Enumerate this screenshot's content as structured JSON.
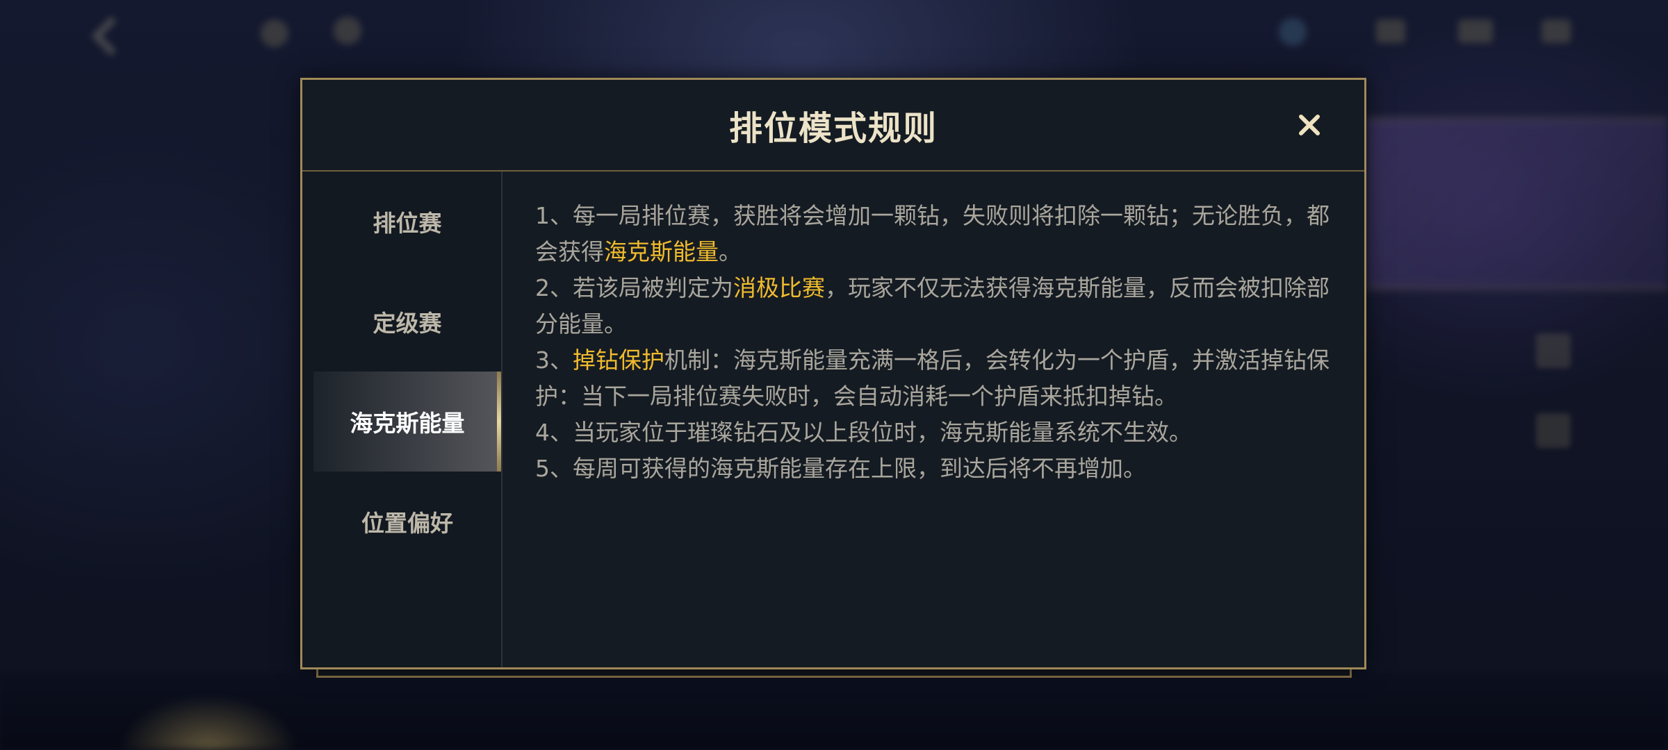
{
  "modal": {
    "title": "排位模式规则",
    "close_icon": "close-icon"
  },
  "sidebar": {
    "items": [
      {
        "label": "排位赛",
        "active": false
      },
      {
        "label": "定级赛",
        "active": false
      },
      {
        "label": "海克斯能量",
        "active": true
      },
      {
        "label": "位置偏好",
        "active": false
      }
    ]
  },
  "rules": [
    {
      "parts": [
        {
          "text": "1、每一局排位赛，获胜将会增加一颗钻，失败则将扣除一颗钻；无论胜负，都会获得"
        },
        {
          "text": "海克斯能量",
          "highlight": true
        },
        {
          "text": "。"
        }
      ]
    },
    {
      "parts": [
        {
          "text": "2、若该局被判定为"
        },
        {
          "text": "消极比赛",
          "highlight": true
        },
        {
          "text": "，玩家不仅无法获得海克斯能量，反而会被扣除部分能量。"
        }
      ]
    },
    {
      "parts": [
        {
          "text": "3、"
        },
        {
          "text": "掉钻保护",
          "highlight": true
        },
        {
          "text": "机制：海克斯能量充满一格后，会转化为一个护盾，并激活掉钻保护：当下一局排位赛失败时，会自动消耗一个护盾来抵扣掉钻。"
        }
      ]
    },
    {
      "parts": [
        {
          "text": "4、当玩家位于璀璨钻石及以上段位时，海克斯能量系统不生效。"
        }
      ]
    },
    {
      "parts": [
        {
          "text": "5、每周可获得的海克斯能量存在上限，到达后将不再增加。"
        }
      ]
    }
  ],
  "colors": {
    "highlight": "#f0bb2e",
    "border_gold": "#a08a58",
    "panel_bg": "#151b22"
  }
}
